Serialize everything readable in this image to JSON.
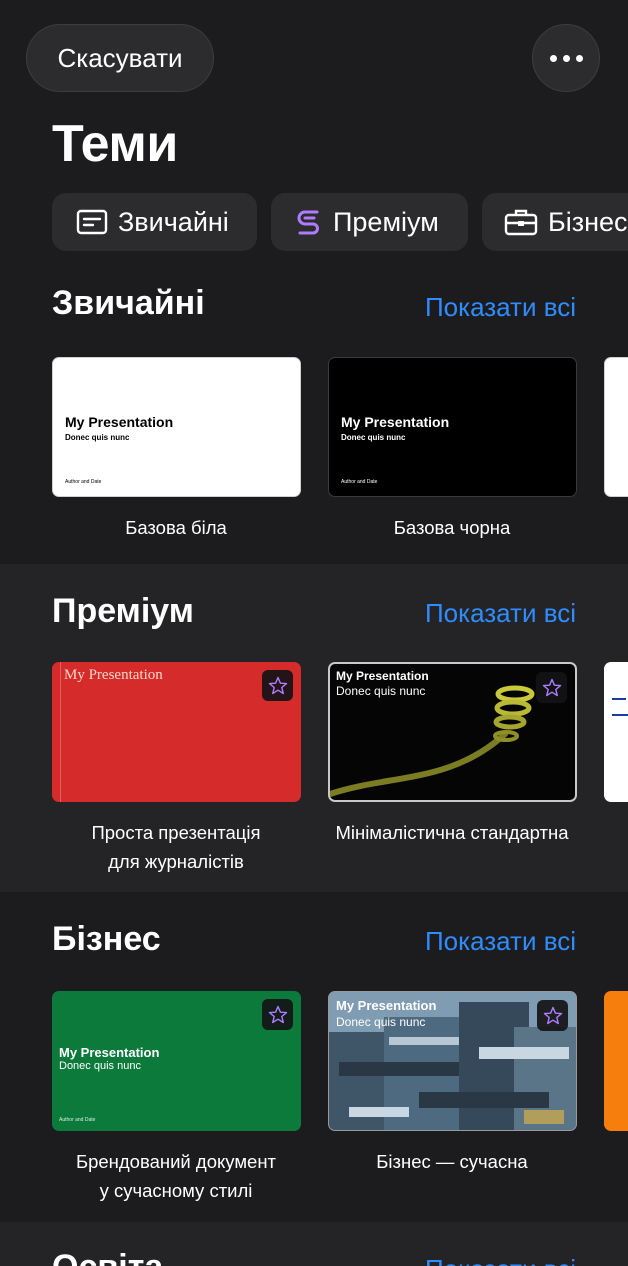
{
  "header": {
    "cancel_label": "Скасувати",
    "title": "Теми"
  },
  "chips": [
    {
      "label": "Звичайні",
      "icon": "basic-slides-icon"
    },
    {
      "label": "Преміум",
      "icon": "premium-swirl-icon",
      "icon_color": "#b07cff"
    },
    {
      "label": "Бізнес",
      "icon": "briefcase-icon"
    }
  ],
  "colors": {
    "background": "#1c1c1e",
    "section_alt": "#242426",
    "accent": "#2f8cff",
    "premium": "#b07cff"
  },
  "sections": [
    {
      "title": "Звичайні",
      "show_all": "Показати всі",
      "themes": [
        {
          "name": "Базова біла",
          "slide_title": "My Presentation",
          "slide_subtitle": "Donec quis nunc",
          "slide_footer": "Author and Date"
        },
        {
          "name": "Базова чорна",
          "slide_title": "My Presentation",
          "slide_subtitle": "Donec quis nunc",
          "slide_footer": "Author and Date"
        }
      ]
    },
    {
      "title": "Преміум",
      "show_all": "Показати всі",
      "themes": [
        {
          "name_line1": "Проста презентація",
          "name_line2": "для журналістів",
          "slide_title": "My Presentation",
          "premium": true
        },
        {
          "name": "Мінімалістична стандартна",
          "slide_title": "My Presentation",
          "slide_subtitle": "Donec quis nunc",
          "premium": true
        }
      ]
    },
    {
      "title": "Бізнес",
      "show_all": "Показати всі",
      "themes": [
        {
          "name_line1": "Брендований документ",
          "name_line2": "у сучасному стилі",
          "slide_title": "My Presentation",
          "slide_subtitle": "Donec quis nunc",
          "slide_footer": "Author and Date",
          "premium": true
        },
        {
          "name": "Бізнес — сучасна",
          "slide_title": "My Presentation",
          "slide_subtitle": "Donec quis nunc",
          "premium": true
        }
      ]
    },
    {
      "title": "Освіта",
      "show_all": "Показати всі"
    }
  ]
}
